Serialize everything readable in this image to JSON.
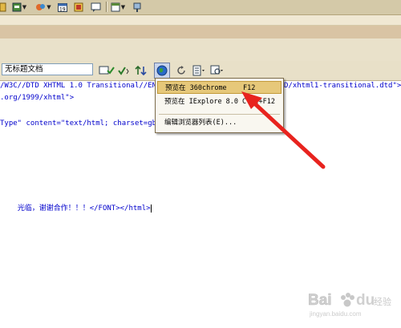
{
  "document_toolbar": {
    "title_input_value": "无标题文档"
  },
  "code_lines": [
    "/W3C//DTD XHTML 1.0 Transitional//EN\"",
    "D/xhtml1-transitional.dtd\">",
    ".org/1999/xhtml\">",
    "Type\" content=\"text/html; charset=gb2",
    "光临，谢谢合作！！！</FONT></html>"
  ],
  "preview_menu": {
    "items": [
      {
        "label": "预览在 360chrome",
        "shortcut": "F12"
      },
      {
        "label": "预览在 IExplore 8.0",
        "shortcut": "Ctrl+F12"
      },
      {
        "label": "编辑浏览器列表(E)...",
        "shortcut": ""
      }
    ]
  },
  "watermark": {
    "text": "Baidu 经验",
    "sub": "jingyan.baidu.com"
  },
  "colors": {
    "arrow": "#e8231e",
    "highlight": "#e6c87a"
  }
}
